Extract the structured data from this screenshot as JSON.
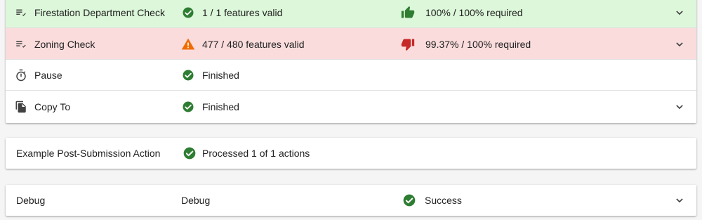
{
  "colors": {
    "valid_bg": "#dcf7d9",
    "invalid_bg": "#fadcdc",
    "success_green": "#2e7d32",
    "warning_orange": "#e65100",
    "thumb_up_green": "#2e7d32",
    "thumb_down_red": "#c62828",
    "icon_gray": "#424242"
  },
  "workflow_steps": [
    {
      "type_icon": "checklist-icon",
      "name": "Firestation Department Check",
      "status_icon": "check-circle-icon",
      "status": "1 / 1 features valid",
      "requirement_icon": "thumb-up-icon",
      "requirement": "100% / 100% required",
      "expandable": true
    },
    {
      "type_icon": "checklist-icon",
      "name": "Zoning Check",
      "status_icon": "warning-icon",
      "status": "477 / 480 features valid",
      "requirement_icon": "thumb-down-icon",
      "requirement": "99.37% / 100% required",
      "expandable": true
    },
    {
      "type_icon": "timer-icon",
      "name": "Pause",
      "status_icon": "check-circle-icon",
      "status": "Finished",
      "expandable": false
    },
    {
      "type_icon": "copy-icon",
      "name": "Copy To",
      "status_icon": "check-circle-icon",
      "status": "Finished",
      "expandable": true
    }
  ],
  "post_submission": {
    "name": "Example Post-Submission Action",
    "status_icon": "check-circle-icon",
    "status": "Processed 1 of 1 actions"
  },
  "debug": {
    "name": "Debug",
    "type": "Debug",
    "status_icon": "check-circle-icon",
    "status": "Success",
    "expandable": true
  }
}
